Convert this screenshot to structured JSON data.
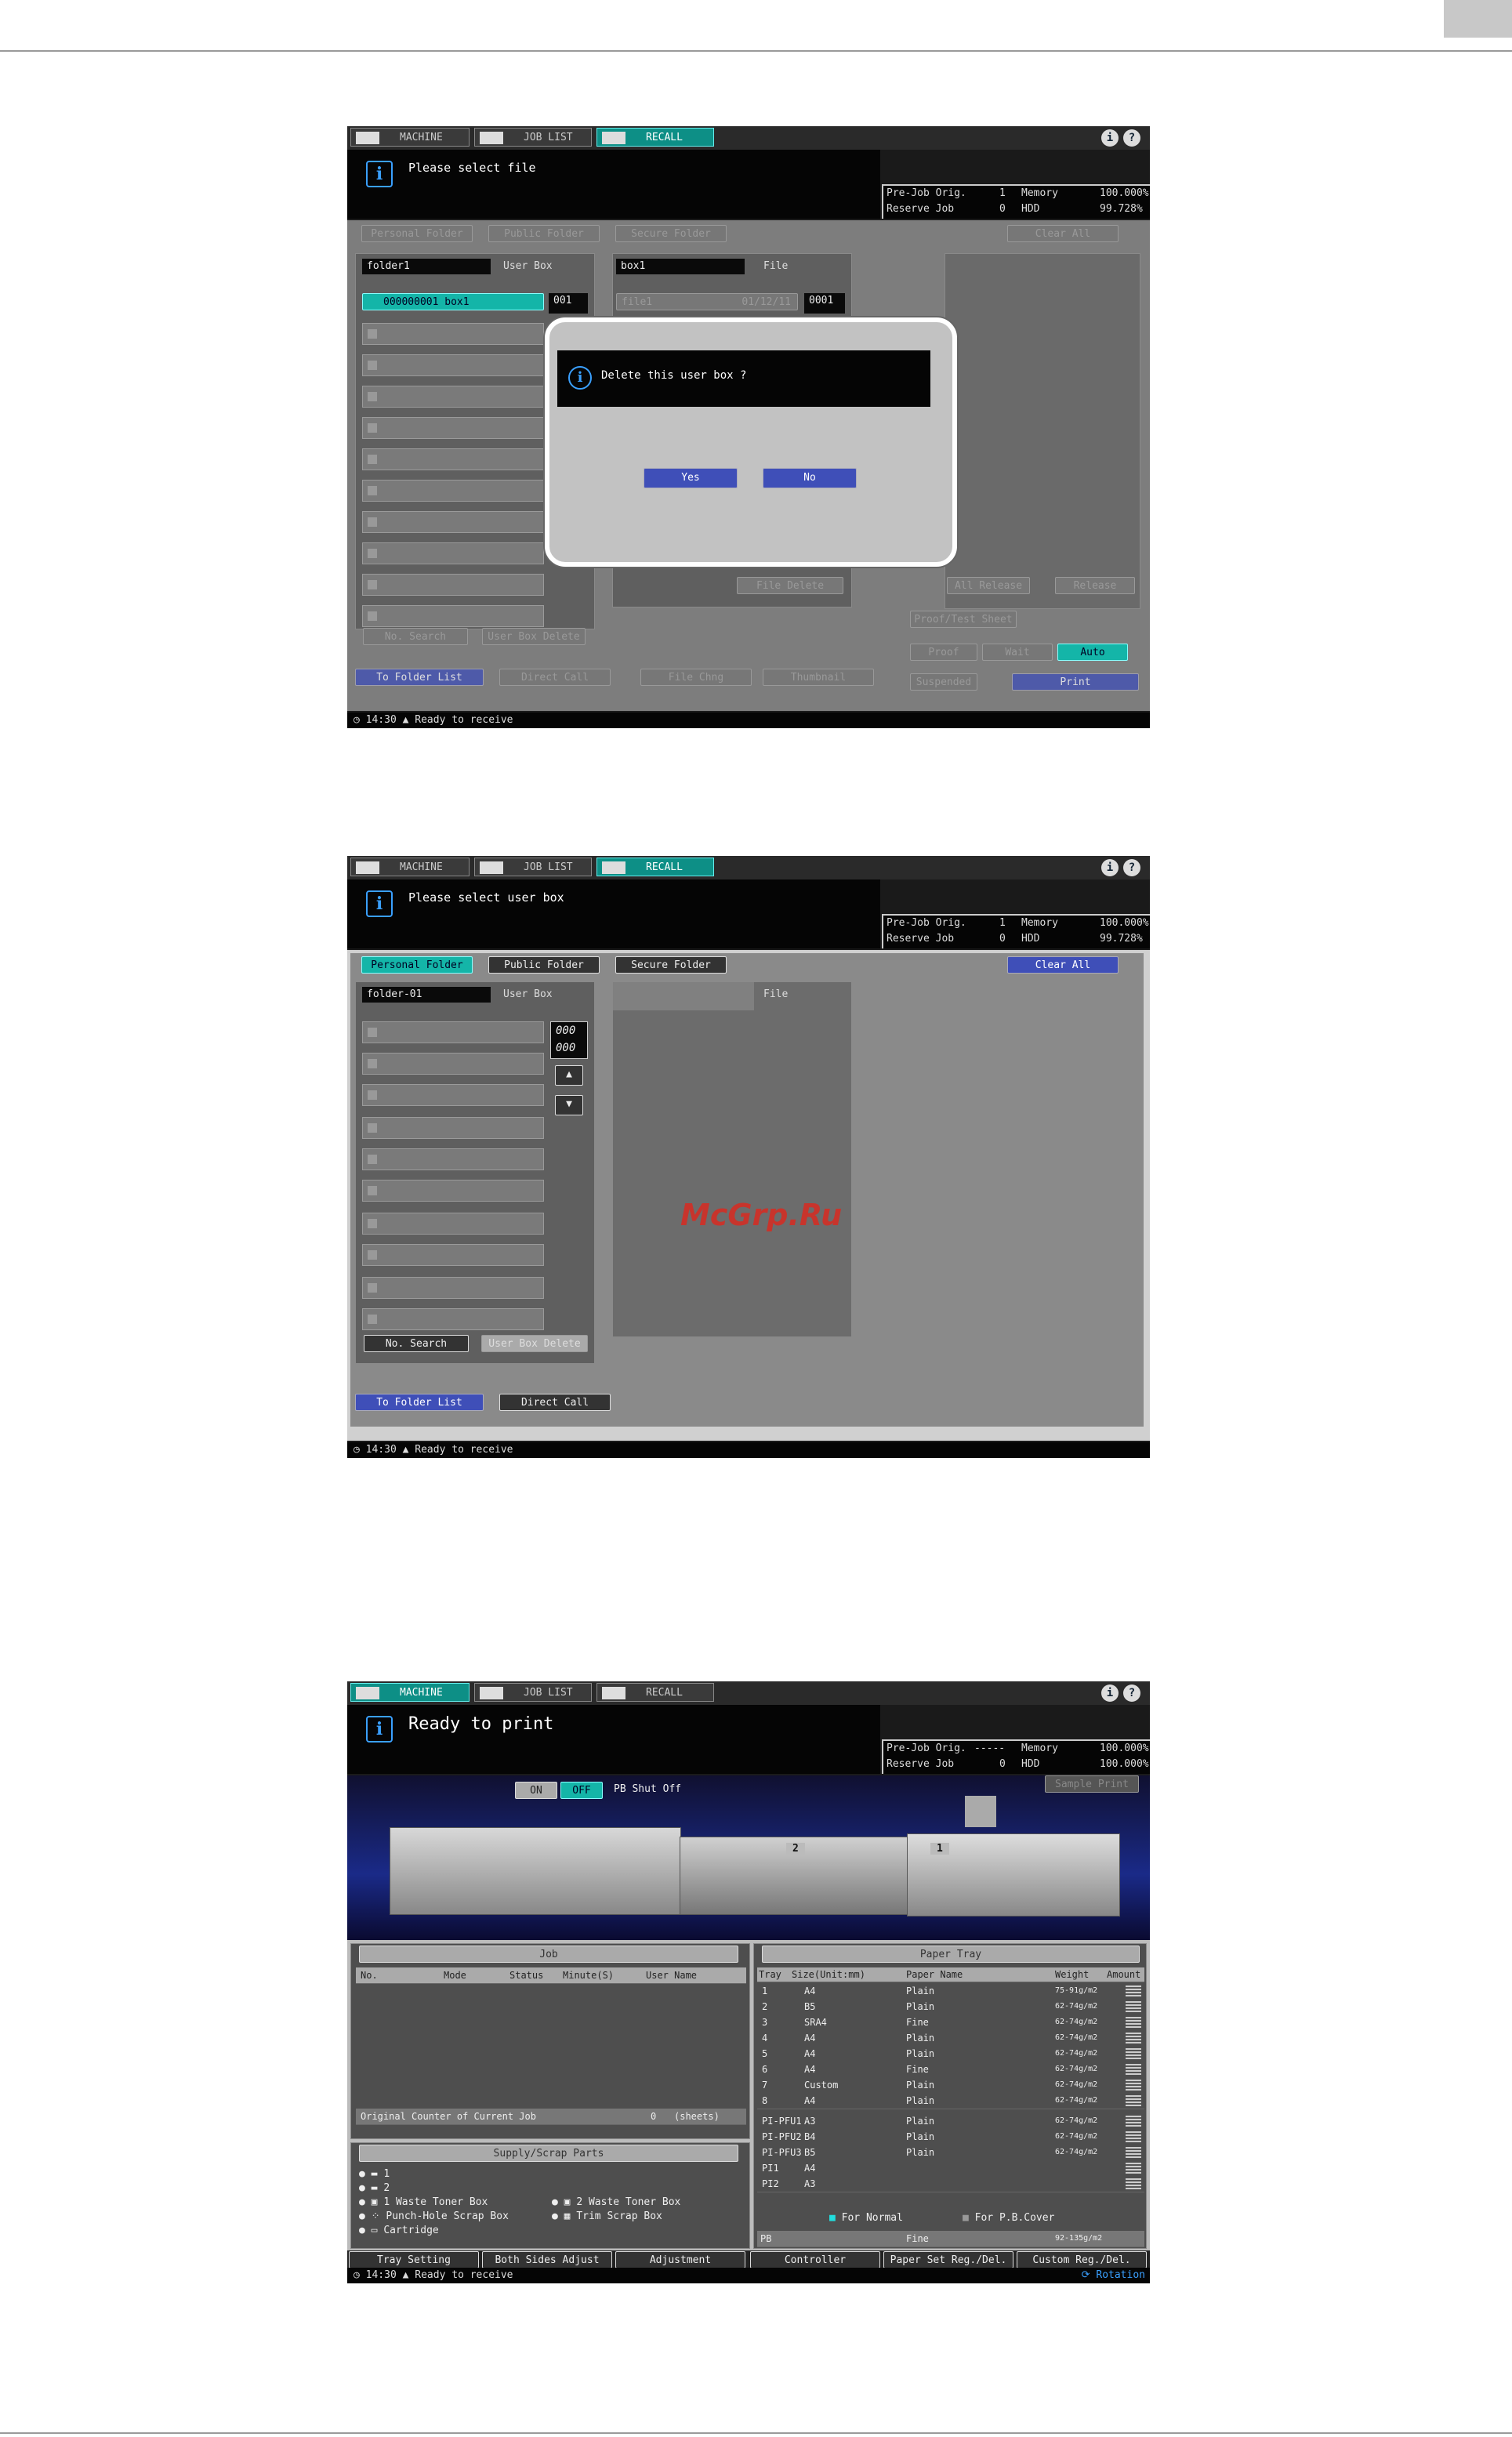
{
  "shot1": {
    "tabs": [
      "MACHINE",
      "JOB LIST",
      "RECALL"
    ],
    "message": "Please select file",
    "status": {
      "prejob_label": "Pre-Job Orig.",
      "prejob_val": "1",
      "memory_label": "Memory",
      "memory_val": "100.000%",
      "reserve_label": "Reserve Job",
      "reserve_val": "0",
      "hdd_label": "HDD",
      "hdd_val": "99.728%"
    },
    "folder_tabs": [
      "Personal Folder",
      "Public Folder",
      "Secure Folder"
    ],
    "clear_all": "Clear All",
    "folder_name": "folder1",
    "user_box_label": "User Box",
    "box_name": "box1",
    "file_label": "File",
    "box_row": "000000001 box1",
    "box_count": "001",
    "file_row": "file1",
    "file_date": "01/12/11",
    "file_count": "0001",
    "dialog_message": "Delete this user box ?",
    "yes": "Yes",
    "no": "No",
    "file_delete": "File Delete",
    "all_release": "All Release",
    "release": "Release",
    "no_search": "No. Search",
    "user_box_delete": "User Box Delete",
    "proof_sheet": "Proof/Test Sheet",
    "proof": "Proof",
    "wait": "Wait",
    "auto": "Auto",
    "to_folder_list": "To Folder List",
    "direct_call": "Direct Call",
    "file_chng": "File Chng",
    "thumbnail": "Thumbnail",
    "suspended": "Suspended",
    "print": "Print",
    "time": "14:30",
    "ready": "Ready to receive"
  },
  "shot2": {
    "tabs": [
      "MACHINE",
      "JOB LIST",
      "RECALL"
    ],
    "message": "Please select user box",
    "status": {
      "prejob_label": "Pre-Job Orig.",
      "prejob_val": "1",
      "memory_label": "Memory",
      "memory_val": "100.000%",
      "reserve_label": "Reserve Job",
      "reserve_val": "0",
      "hdd_label": "HDD",
      "hdd_val": "99.728%"
    },
    "folder_tabs": [
      "Personal Folder",
      "Public Folder",
      "Secure Folder"
    ],
    "clear_all": "Clear All",
    "folder_name": "folder-01",
    "user_box_label": "User Box",
    "file_label": "File",
    "count_a": "000",
    "count_b": "000",
    "no_search": "No. Search",
    "user_box_delete": "User Box Delete",
    "to_folder_list": "To Folder List",
    "direct_call": "Direct Call",
    "time": "14:30",
    "ready": "Ready to receive"
  },
  "watermark": "McGrp.Ru",
  "shot3": {
    "tabs": [
      "MACHINE",
      "JOB LIST",
      "RECALL"
    ],
    "message": "Ready to print",
    "status": {
      "prejob_label": "Pre-Job Orig.",
      "prejob_val": "-----",
      "memory_label": "Memory",
      "memory_val": "100.000%",
      "reserve_label": "Reserve Job",
      "reserve_val": "0",
      "hdd_label": "HDD",
      "hdd_val": "100.000%"
    },
    "on": "ON",
    "off": "OFF",
    "pb_shutoff": "PB Shut Off",
    "sample_print": "Sample Print",
    "unit_2": "2",
    "unit_1": "1",
    "job_title": "Job",
    "job_cols": [
      "No.",
      "Mode",
      "Status",
      "Minute(S)",
      "User Name"
    ],
    "orig_counter": "Original Counter of Current Job",
    "orig_value": "0",
    "orig_unit": "(sheets)",
    "supply_title": "Supply/Scrap Parts",
    "supply_items": [
      "1",
      "2",
      "1 Waste Toner Box",
      "Punch-Hole Scrap Box",
      "Cartridge"
    ],
    "supply_items_r": [
      "2 Waste Toner Box",
      "Trim Scrap Box"
    ],
    "tray_title": "Paper Tray",
    "tray_cols": [
      "Tray",
      "Size(Unit:mm)",
      "Paper Name",
      "Weight",
      "Amount"
    ],
    "trays": [
      {
        "tray": "1",
        "size": "A4",
        "name": "Plain",
        "weight": "75-91g/m2"
      },
      {
        "tray": "2",
        "size": "B5",
        "name": "Plain",
        "weight": "62-74g/m2"
      },
      {
        "tray": "3",
        "size": "SRA4",
        "name": "Fine",
        "weight": "62-74g/m2"
      },
      {
        "tray": "4",
        "size": "A4",
        "name": "Plain",
        "weight": "62-74g/m2"
      },
      {
        "tray": "5",
        "size": "A4",
        "name": "Plain",
        "weight": "62-74g/m2"
      },
      {
        "tray": "6",
        "size": "A4",
        "name": "Fine",
        "weight": "62-74g/m2"
      },
      {
        "tray": "7",
        "size": "Custom",
        "name": "Plain",
        "weight": "62-74g/m2"
      },
      {
        "tray": "8",
        "size": "A4",
        "name": "Plain",
        "weight": "62-74g/m2"
      }
    ],
    "pi_trays": [
      {
        "tray": "PI-PFU1",
        "size": "A3",
        "name": "Plain",
        "weight": "62-74g/m2"
      },
      {
        "tray": "PI-PFU2",
        "size": "B4",
        "name": "Plain",
        "weight": "62-74g/m2"
      },
      {
        "tray": "PI-PFU3",
        "size": "B5",
        "name": "Plain",
        "weight": "62-74g/m2"
      },
      {
        "tray": "PI1",
        "size": "A4",
        "name": "",
        "weight": ""
      },
      {
        "tray": "PI2",
        "size": "A3",
        "name": "",
        "weight": ""
      }
    ],
    "for_normal": "For Normal",
    "for_pb": "For P.B.Cover",
    "pb_row": {
      "tray": "PB",
      "name": "Fine",
      "weight": "92-135g/m2"
    },
    "bottom_buttons": [
      "Tray Setting",
      "Both Sides Adjust",
      "Adjustment",
      "Controller",
      "Paper Set Reg./Del.",
      "Custom Reg./Del."
    ],
    "rotation": "Rotation",
    "time": "14:30",
    "ready": "Ready to receive"
  }
}
